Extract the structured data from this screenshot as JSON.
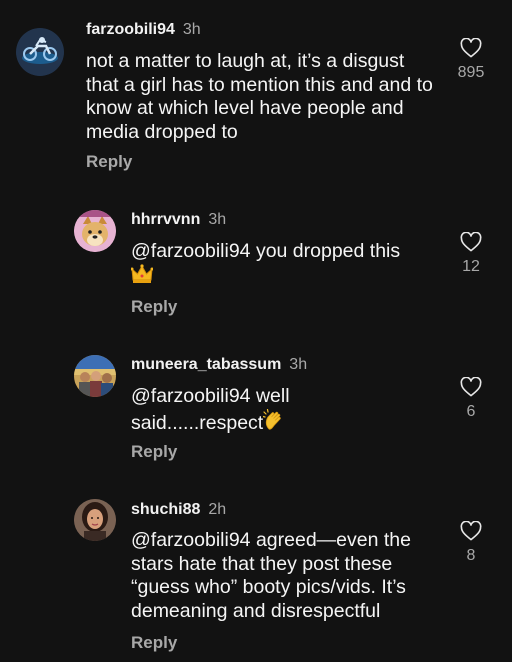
{
  "comments": [
    {
      "username": "farzoobili94",
      "time": "3h",
      "text": "not a matter to laugh at, it’s a disgust that a girl has to mention this and and to know at which level have people and media dropped to",
      "likes": "895",
      "reply_label": "Reply",
      "avatar_icon": "motorcycle-logo-icon"
    },
    {
      "username": "hhrrvvnn",
      "time": "3h",
      "text": "@farzoobili94 you dropped this",
      "emoji": "crown-emoji",
      "likes": "12",
      "reply_label": "Reply",
      "avatar_icon": "doge-avatar-icon"
    },
    {
      "username": "muneera_tabassum",
      "time": "3h",
      "text": "@farzoobili94 well said......respect",
      "emoji": "clapping-hands-emoji",
      "likes": "6",
      "reply_label": "Reply",
      "avatar_icon": "group-photo-avatar-icon"
    },
    {
      "username": "shuchi88",
      "time": "2h",
      "text": "@farzoobili94 agreed—even the stars hate that they post these “guess who” booty pics/vids. It’s demeaning and disrespectful",
      "likes": "8",
      "reply_label": "Reply",
      "avatar_icon": "woman-portrait-avatar-icon"
    }
  ],
  "colors": {
    "background": "#121212",
    "text": "#f5f5f5",
    "secondary": "#a8a8a8"
  }
}
